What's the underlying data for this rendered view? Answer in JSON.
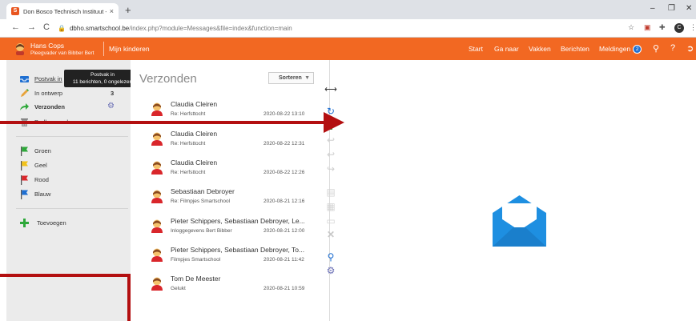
{
  "browser": {
    "tab_title": "Don Bosco Technisch Instituut - S",
    "tab_favicon": "S",
    "tab_close": "×",
    "new_tab": "+",
    "win_min": "–",
    "win_max": "❐",
    "win_close": "✕",
    "back": "←",
    "forward": "→",
    "reload": "C",
    "url_host": "dbho.smartschool.be",
    "url_path": "/index.php?module=Messages&file=index&function=main",
    "profile_initial": "C"
  },
  "header": {
    "user_name": "Hans Cops",
    "user_role": "Pleegvader van Bibber Bert",
    "my_children": "Mijn kinderen",
    "nav": [
      "Start",
      "Ga naar",
      "Vakken",
      "Berichten",
      "Meldingen"
    ],
    "notifications_count": "2",
    "accent": "#f26822"
  },
  "sidebar": {
    "folders": [
      {
        "label": "Postvak in",
        "count": ""
      },
      {
        "label": "In ontwerp",
        "count": "3"
      },
      {
        "label": "Verzonden",
        "count": ""
      },
      {
        "label": "Prullenmand",
        "count": ""
      }
    ],
    "labels": [
      {
        "label": "Groen",
        "color": "#2ea83a"
      },
      {
        "label": "Geel",
        "color": "#f2c21b"
      },
      {
        "label": "Rood",
        "color": "#d9262b"
      },
      {
        "label": "Blauw",
        "color": "#1f6fd1"
      }
    ],
    "add_label": "Toevoegen",
    "tooltip_title": "Postvak in",
    "tooltip_detail": "11 berichten, 0 ongelezen"
  },
  "list": {
    "title": "Verzonden",
    "sort_label": "Sorteren",
    "messages": [
      {
        "to": "Claudia Cleiren",
        "subject": "Re: Herfsttocht",
        "date": "2020-08-22 13:10"
      },
      {
        "to": "Claudia Cleiren",
        "subject": "Re: Herfsttocht",
        "date": "2020-08-22 12:31"
      },
      {
        "to": "Claudia Cleiren",
        "subject": "Re: Herfsttocht",
        "date": "2020-08-22 12:26"
      },
      {
        "to": "Sebastiaan Debroyer",
        "subject": "Re: Filmpjes Smartschool",
        "date": "2020-08-21 12:16"
      },
      {
        "to": "Pieter Schippers, Sebastiaan Debroyer, Le...",
        "subject": "Inloggegevens Bert Bibber",
        "date": "2020-08-21 12:00"
      },
      {
        "to": "Pieter Schippers, Sebastiaan Debroyer, To...",
        "subject": "Filmpjes Smartschool",
        "date": "2020-08-21 11:42"
      },
      {
        "to": "Tom De Meester",
        "subject": "Gelukt",
        "date": "2020-08-21 10:59"
      }
    ]
  },
  "toolbar": {
    "icons": [
      "resize-icon",
      "refresh-icon",
      "new-message-icon",
      "reply-icon",
      "reply-all-icon",
      "forward-icon",
      "print-icon",
      "archive-icon",
      "move-icon",
      "delete-icon",
      "search-icon",
      "settings-icon"
    ]
  }
}
